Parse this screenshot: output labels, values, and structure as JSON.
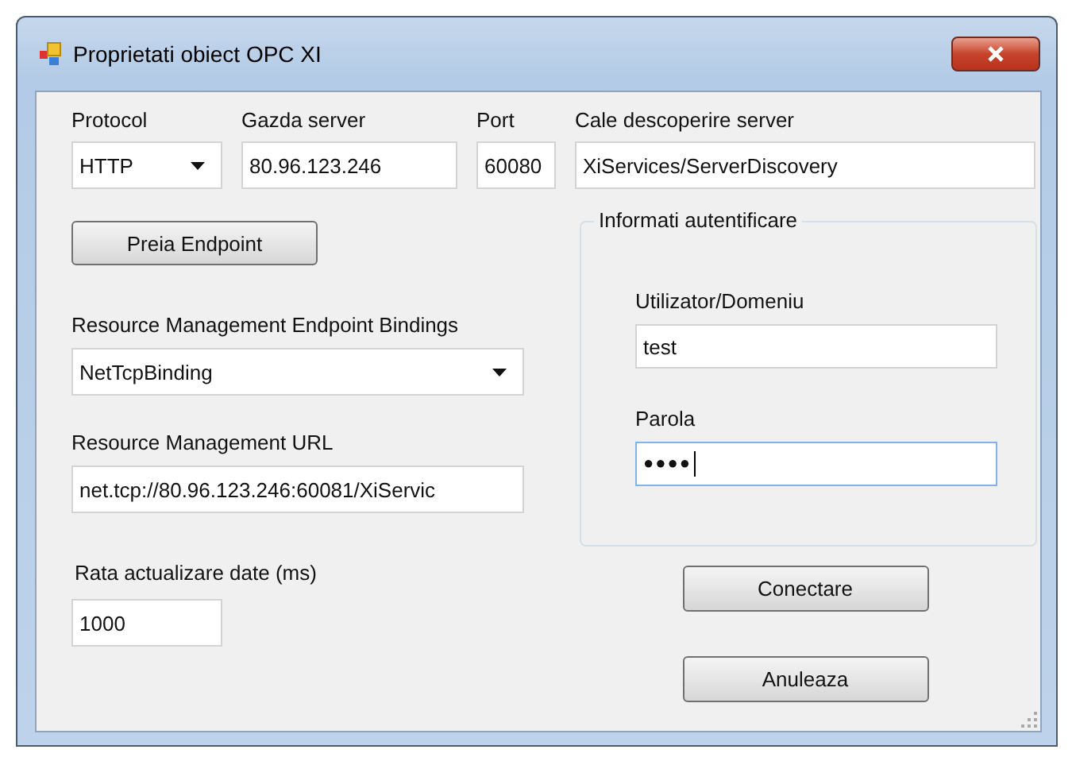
{
  "window": {
    "title": "Proprietati obiect OPC XI"
  },
  "connection": {
    "protocol_label": "Protocol",
    "protocol": "HTTP",
    "host_label": "Gazda server",
    "host": "80.96.123.246",
    "port_label": "Port",
    "port": "60080",
    "path_label": "Cale descoperire server",
    "path": "XiServices/ServerDiscovery"
  },
  "fetch_button": "Preia Endpoint",
  "bindings": {
    "label": "Resource Management Endpoint Bindings",
    "value": "NetTcpBinding"
  },
  "url": {
    "label": "Resource Management URL",
    "value": "net.tcp://80.96.123.246:60081/XiServic"
  },
  "refresh": {
    "label": "Rata actualizare date (ms)",
    "value": "1000"
  },
  "auth": {
    "title": "Informati autentificare",
    "user_label": "Utilizator/Domeniu",
    "user": "test",
    "password_label": "Parola",
    "password": "●●●●",
    "focused": true
  },
  "buttons": [
    "Conectare",
    "Anuleaza"
  ]
}
